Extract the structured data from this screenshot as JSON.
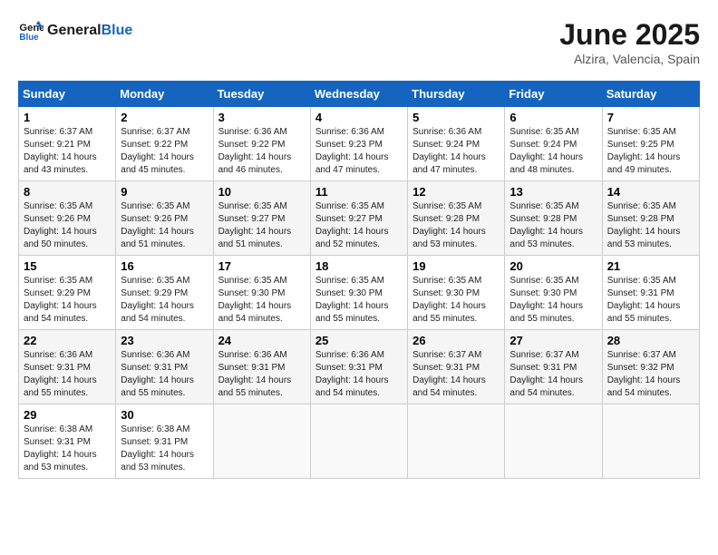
{
  "header": {
    "logo_line1": "General",
    "logo_line2": "Blue",
    "month": "June 2025",
    "location": "Alzira, Valencia, Spain"
  },
  "weekdays": [
    "Sunday",
    "Monday",
    "Tuesday",
    "Wednesday",
    "Thursday",
    "Friday",
    "Saturday"
  ],
  "weeks": [
    [
      {
        "day": "1",
        "sunrise": "6:37 AM",
        "sunset": "9:21 PM",
        "daylight": "14 hours and 43 minutes."
      },
      {
        "day": "2",
        "sunrise": "6:37 AM",
        "sunset": "9:22 PM",
        "daylight": "14 hours and 45 minutes."
      },
      {
        "day": "3",
        "sunrise": "6:36 AM",
        "sunset": "9:22 PM",
        "daylight": "14 hours and 46 minutes."
      },
      {
        "day": "4",
        "sunrise": "6:36 AM",
        "sunset": "9:23 PM",
        "daylight": "14 hours and 47 minutes."
      },
      {
        "day": "5",
        "sunrise": "6:36 AM",
        "sunset": "9:24 PM",
        "daylight": "14 hours and 47 minutes."
      },
      {
        "day": "6",
        "sunrise": "6:35 AM",
        "sunset": "9:24 PM",
        "daylight": "14 hours and 48 minutes."
      },
      {
        "day": "7",
        "sunrise": "6:35 AM",
        "sunset": "9:25 PM",
        "daylight": "14 hours and 49 minutes."
      }
    ],
    [
      {
        "day": "8",
        "sunrise": "6:35 AM",
        "sunset": "9:26 PM",
        "daylight": "14 hours and 50 minutes."
      },
      {
        "day": "9",
        "sunrise": "6:35 AM",
        "sunset": "9:26 PM",
        "daylight": "14 hours and 51 minutes."
      },
      {
        "day": "10",
        "sunrise": "6:35 AM",
        "sunset": "9:27 PM",
        "daylight": "14 hours and 51 minutes."
      },
      {
        "day": "11",
        "sunrise": "6:35 AM",
        "sunset": "9:27 PM",
        "daylight": "14 hours and 52 minutes."
      },
      {
        "day": "12",
        "sunrise": "6:35 AM",
        "sunset": "9:28 PM",
        "daylight": "14 hours and 53 minutes."
      },
      {
        "day": "13",
        "sunrise": "6:35 AM",
        "sunset": "9:28 PM",
        "daylight": "14 hours and 53 minutes."
      },
      {
        "day": "14",
        "sunrise": "6:35 AM",
        "sunset": "9:28 PM",
        "daylight": "14 hours and 53 minutes."
      }
    ],
    [
      {
        "day": "15",
        "sunrise": "6:35 AM",
        "sunset": "9:29 PM",
        "daylight": "14 hours and 54 minutes."
      },
      {
        "day": "16",
        "sunrise": "6:35 AM",
        "sunset": "9:29 PM",
        "daylight": "14 hours and 54 minutes."
      },
      {
        "day": "17",
        "sunrise": "6:35 AM",
        "sunset": "9:30 PM",
        "daylight": "14 hours and 54 minutes."
      },
      {
        "day": "18",
        "sunrise": "6:35 AM",
        "sunset": "9:30 PM",
        "daylight": "14 hours and 55 minutes."
      },
      {
        "day": "19",
        "sunrise": "6:35 AM",
        "sunset": "9:30 PM",
        "daylight": "14 hours and 55 minutes."
      },
      {
        "day": "20",
        "sunrise": "6:35 AM",
        "sunset": "9:30 PM",
        "daylight": "14 hours and 55 minutes."
      },
      {
        "day": "21",
        "sunrise": "6:35 AM",
        "sunset": "9:31 PM",
        "daylight": "14 hours and 55 minutes."
      }
    ],
    [
      {
        "day": "22",
        "sunrise": "6:36 AM",
        "sunset": "9:31 PM",
        "daylight": "14 hours and 55 minutes."
      },
      {
        "day": "23",
        "sunrise": "6:36 AM",
        "sunset": "9:31 PM",
        "daylight": "14 hours and 55 minutes."
      },
      {
        "day": "24",
        "sunrise": "6:36 AM",
        "sunset": "9:31 PM",
        "daylight": "14 hours and 55 minutes."
      },
      {
        "day": "25",
        "sunrise": "6:36 AM",
        "sunset": "9:31 PM",
        "daylight": "14 hours and 54 minutes."
      },
      {
        "day": "26",
        "sunrise": "6:37 AM",
        "sunset": "9:31 PM",
        "daylight": "14 hours and 54 minutes."
      },
      {
        "day": "27",
        "sunrise": "6:37 AM",
        "sunset": "9:31 PM",
        "daylight": "14 hours and 54 minutes."
      },
      {
        "day": "28",
        "sunrise": "6:37 AM",
        "sunset": "9:32 PM",
        "daylight": "14 hours and 54 minutes."
      }
    ],
    [
      {
        "day": "29",
        "sunrise": "6:38 AM",
        "sunset": "9:31 PM",
        "daylight": "14 hours and 53 minutes."
      },
      {
        "day": "30",
        "sunrise": "6:38 AM",
        "sunset": "9:31 PM",
        "daylight": "14 hours and 53 minutes."
      },
      null,
      null,
      null,
      null,
      null
    ]
  ]
}
